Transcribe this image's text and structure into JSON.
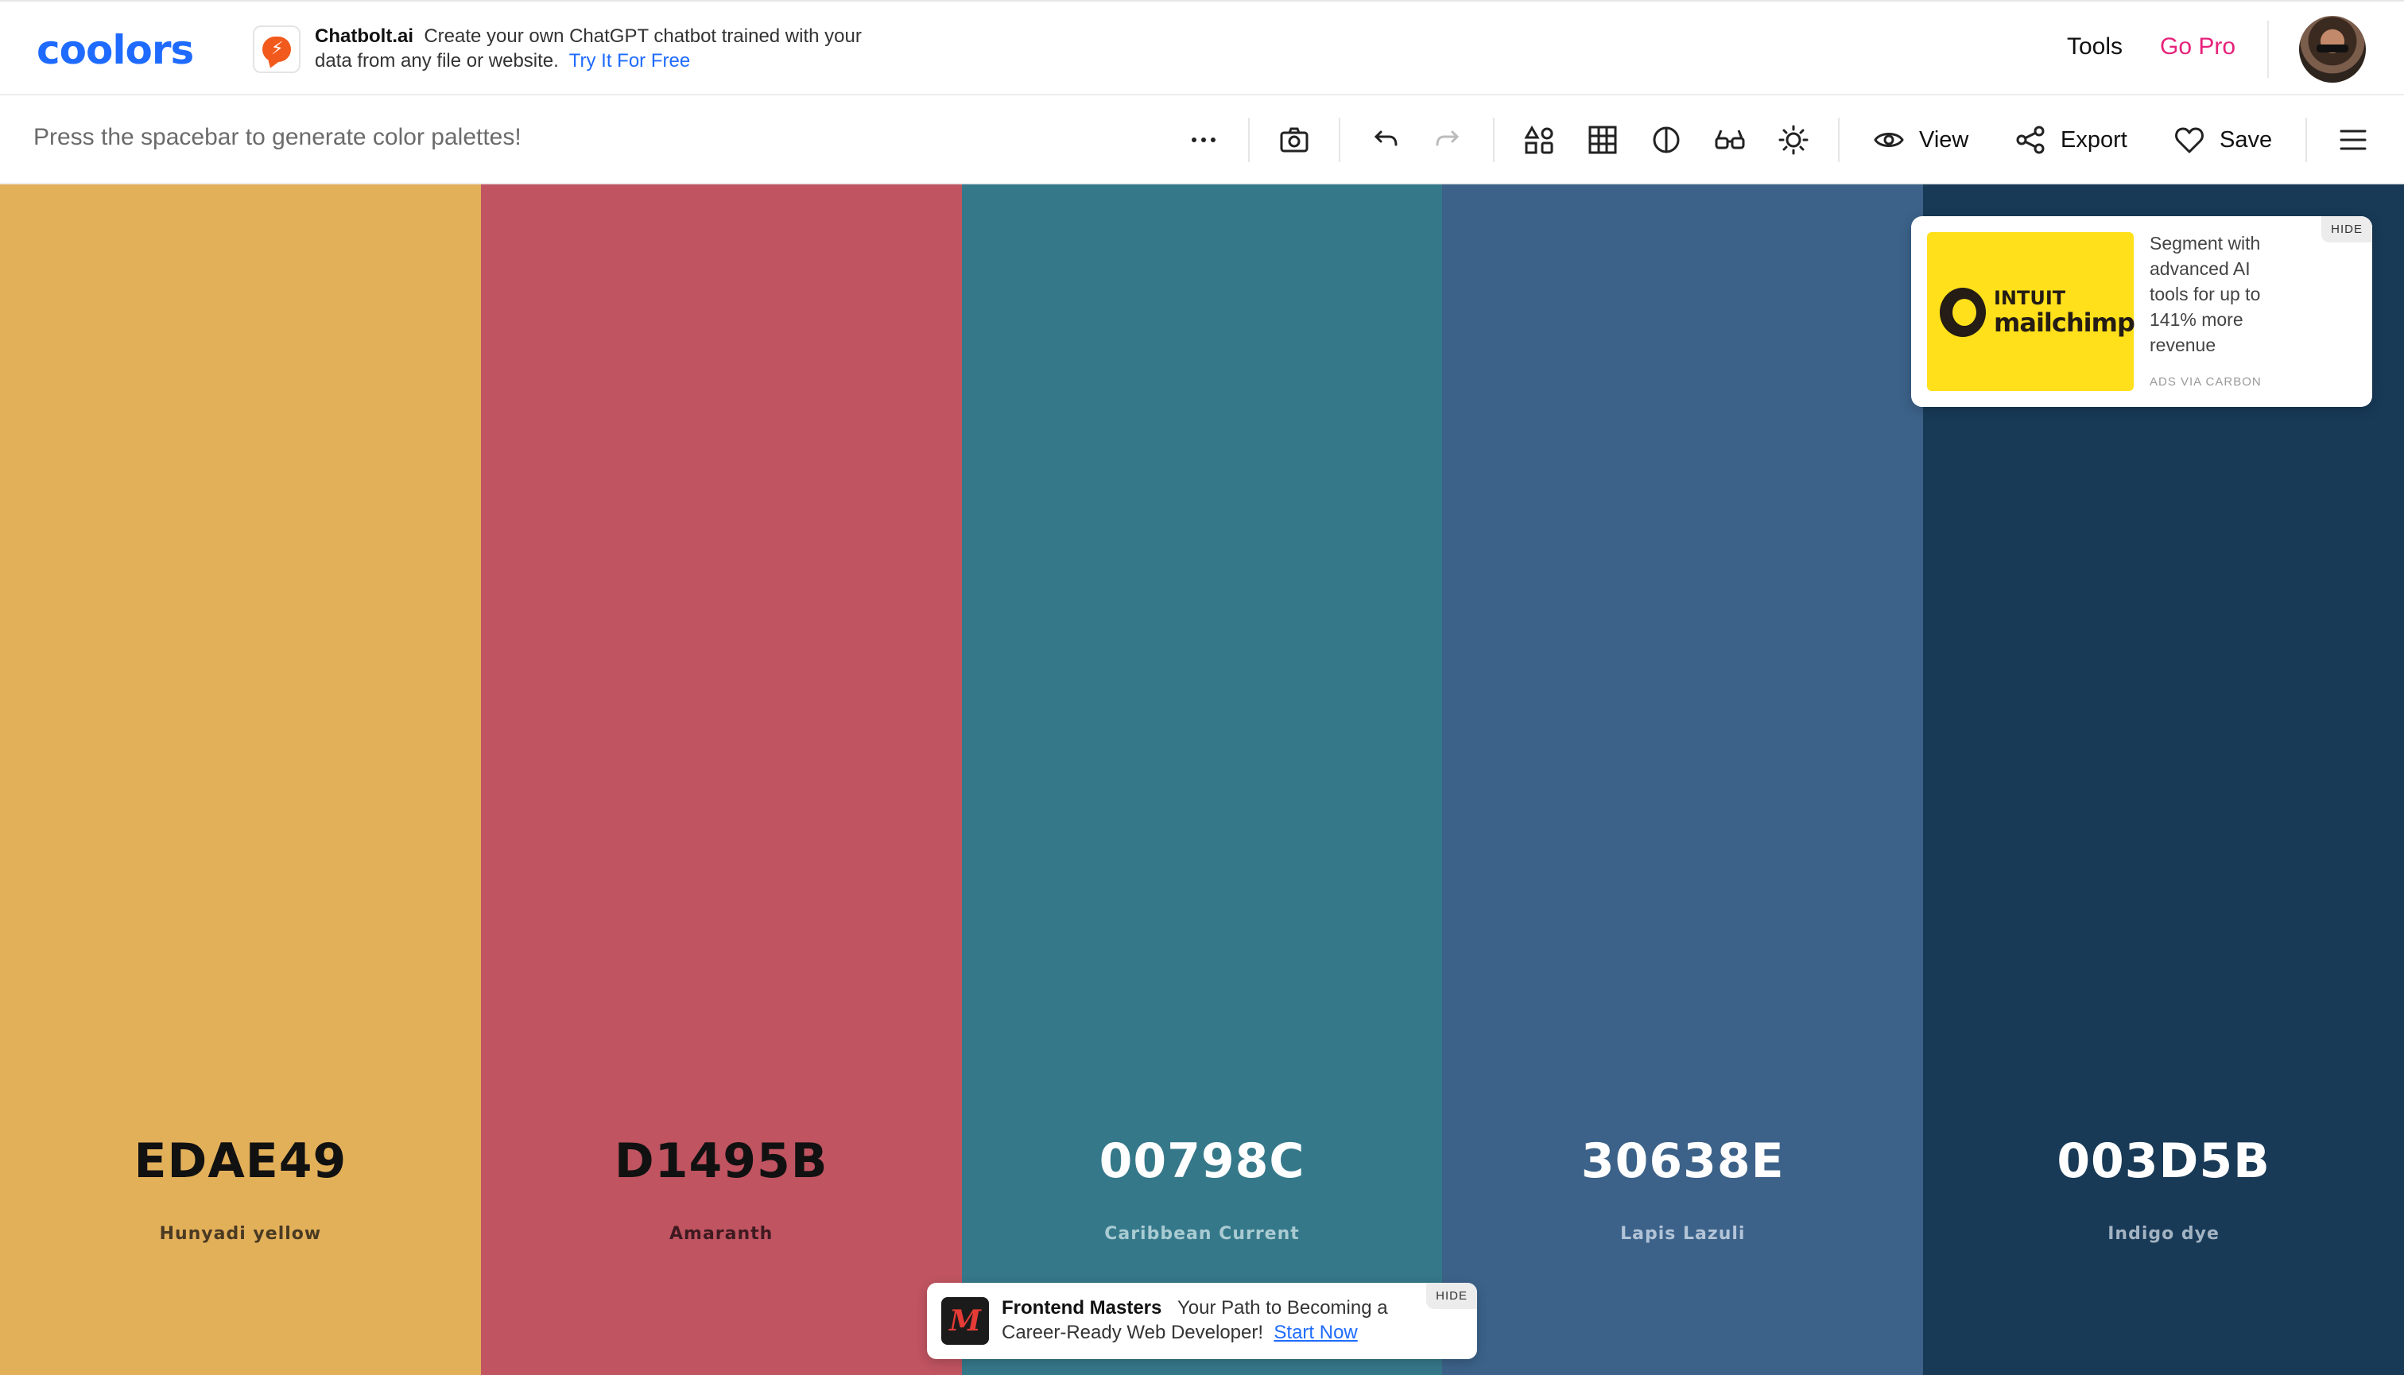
{
  "header": {
    "logo": "coolors",
    "promo": {
      "brand": "Chatbolt.ai",
      "text": "Create your own ChatGPT chatbot trained with your data from any file or website.",
      "link": "Try It For Free"
    },
    "nav": {
      "tools": "Tools",
      "pro": "Go Pro"
    }
  },
  "toolbar": {
    "hint": "Press the spacebar to generate color palettes!",
    "view": "View",
    "export": "Export",
    "save": "Save"
  },
  "palette": [
    {
      "hex": "EDAE49",
      "name": "Hunyadi yellow",
      "bg": "#e3b05a",
      "text": "#111111",
      "sub": "#4a3a22"
    },
    {
      "hex": "D1495B",
      "name": "Amaranth",
      "bg": "#c05461",
      "text": "#111111",
      "sub": "#3e1a20"
    },
    {
      "hex": "00798C",
      "name": "Caribbean Current",
      "bg": "#35788a",
      "text": "#ffffff",
      "sub": "#a9cbd2"
    },
    {
      "hex": "30638E",
      "name": "Lapis Lazuli",
      "bg": "#3c6289",
      "text": "#ffffff",
      "sub": "#b3c4d8"
    },
    {
      "hex": "003D5B",
      "name": "Indigo dye",
      "bg": "#183a57",
      "text": "#ffffff",
      "sub": "#a3b3c2"
    }
  ],
  "ad_carbon": {
    "brand_top": "INTUIT",
    "brand_bottom": "mailchimp",
    "text": "Segment with advanced AI tools for up to 141% more revenue",
    "via": "ADS VIA CARBON",
    "hide": "HIDE"
  },
  "ad_bottom": {
    "logo": "M",
    "brand": "Frontend Masters",
    "text": "Your Path to Becoming a Career-Ready Web Developer!",
    "link": "Start Now",
    "hide": "HIDE"
  }
}
